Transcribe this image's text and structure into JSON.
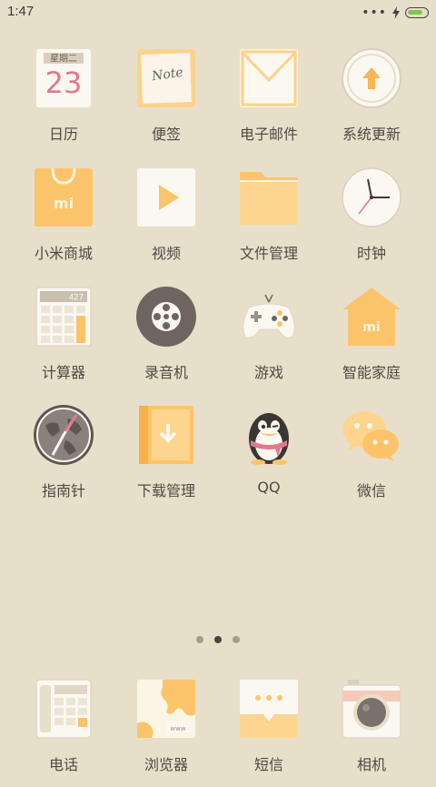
{
  "status_bar": {
    "time": "1:47",
    "overflow_dots": "•••",
    "battery_level": 0.85,
    "battery_color": "#7cc84a"
  },
  "calendar_icon": {
    "weekday": "星期二",
    "day": "23"
  },
  "notes_icon": {
    "text": "Note"
  },
  "calculator_icon": {
    "display": "427"
  },
  "browser_icon": {
    "text": "www"
  },
  "apps": [
    {
      "label": "日历",
      "icon": "calendar-icon"
    },
    {
      "label": "便签",
      "icon": "notes-icon"
    },
    {
      "label": "电子邮件",
      "icon": "email-icon"
    },
    {
      "label": "系统更新",
      "icon": "system-update-icon"
    },
    {
      "label": "小米商城",
      "icon": "mi-store-icon"
    },
    {
      "label": "视频",
      "icon": "video-icon"
    },
    {
      "label": "文件管理",
      "icon": "file-manager-icon"
    },
    {
      "label": "时钟",
      "icon": "clock-icon"
    },
    {
      "label": "计算器",
      "icon": "calculator-icon"
    },
    {
      "label": "录音机",
      "icon": "recorder-icon"
    },
    {
      "label": "游戏",
      "icon": "games-icon"
    },
    {
      "label": "智能家庭",
      "icon": "smart-home-icon"
    },
    {
      "label": "指南针",
      "icon": "compass-icon"
    },
    {
      "label": "下载管理",
      "icon": "downloads-icon"
    },
    {
      "label": "QQ",
      "icon": "qq-icon"
    },
    {
      "label": "微信",
      "icon": "wechat-icon"
    }
  ],
  "page_indicator": {
    "count": 3,
    "active": 1
  },
  "dock": [
    {
      "label": "电话",
      "icon": "phone-icon"
    },
    {
      "label": "浏览器",
      "icon": "browser-icon"
    },
    {
      "label": "短信",
      "icon": "messages-icon"
    },
    {
      "label": "相机",
      "icon": "camera-icon"
    }
  ]
}
